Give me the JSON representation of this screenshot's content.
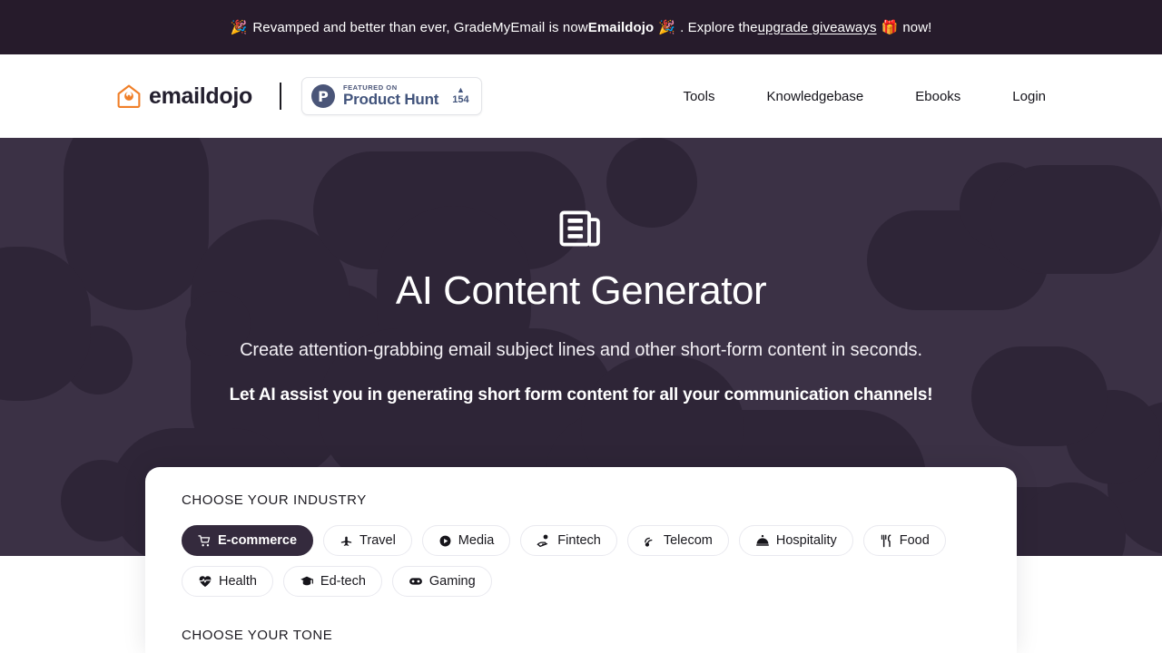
{
  "banner": {
    "emoji_left": "🎉",
    "text_1": "Revamped and better than ever, GradeMyEmail is now ",
    "brand": "Emaildojo",
    "emoji_mid": "🎉",
    "text_2": ". Explore the ",
    "link_text": "upgrade giveaways",
    "emoji_gift": "🎁",
    "text_3": " now!",
    "background_color": "#261b2b"
  },
  "header": {
    "brand_name": "emaildojo",
    "brand_color": "#f07f28",
    "product_hunt": {
      "featured_on": "FEATURED ON",
      "name": "Product Hunt",
      "logo_letter": "P",
      "caret": "▲",
      "votes": "154",
      "color": "#42547c"
    },
    "nav": [
      {
        "label": "Tools"
      },
      {
        "label": "Knowledgebase"
      },
      {
        "label": "Ebooks"
      },
      {
        "label": "Login"
      }
    ]
  },
  "hero": {
    "icon_name": "newspaper-icon",
    "title": "AI Content Generator",
    "subtitle": "Create attention-grabbing email subject lines and other short-form content in seconds.",
    "tagline": "Let AI assist you in generating short form content for all your communication channels!",
    "background_color": "#3b3145",
    "blob_color": "#2e2537"
  },
  "panel": {
    "industry_label": "CHOOSE YOUR INDUSTRY",
    "tone_label": "CHOOSE YOUR TONE",
    "active_industry": "E-commerce",
    "active_color": "#342a3d",
    "industries": [
      {
        "label": "E-commerce",
        "icon": "shopping-cart-icon",
        "active": true
      },
      {
        "label": "Travel",
        "icon": "airplane-icon",
        "active": false
      },
      {
        "label": "Media",
        "icon": "play-circle-icon",
        "active": false
      },
      {
        "label": "Fintech",
        "icon": "hand-coin-icon",
        "active": false
      },
      {
        "label": "Telecom",
        "icon": "signal-icon",
        "active": false
      },
      {
        "label": "Hospitality",
        "icon": "room-service-icon",
        "active": false
      },
      {
        "label": "Food",
        "icon": "fork-knife-icon",
        "active": false
      },
      {
        "label": "Health",
        "icon": "heart-pulse-icon",
        "active": false
      },
      {
        "label": "Ed-tech",
        "icon": "graduation-cap-icon",
        "active": false
      },
      {
        "label": "Gaming",
        "icon": "gamepad-icon",
        "active": false
      }
    ]
  }
}
